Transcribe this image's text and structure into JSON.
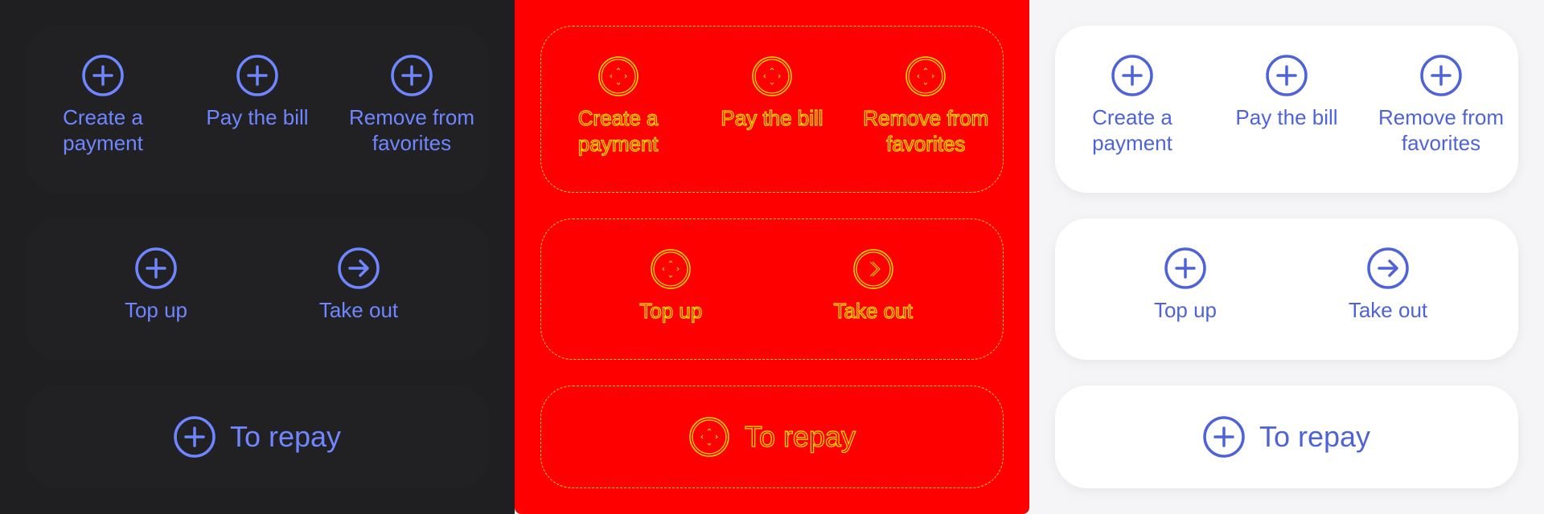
{
  "colors": {
    "dark_background": "#1f1f21",
    "debug_background": "#ff0000",
    "light_background": "#f5f5f7",
    "accent_dark": "#6f86ff",
    "accent_light": "#4f63d9",
    "debug_outline": "#ffe100"
  },
  "actions": {
    "create_payment": {
      "label": "Create a\npayment",
      "icon": "plus-circle-icon"
    },
    "pay_bill": {
      "label": "Pay the bill",
      "icon": "plus-circle-icon"
    },
    "remove_favorites": {
      "label": "Remove from\nfavorites",
      "icon": "plus-circle-icon"
    },
    "top_up": {
      "label": "Top up",
      "icon": "plus-circle-icon"
    },
    "take_out": {
      "label": "Take out",
      "icon": "arrow-right-circle-icon"
    },
    "to_repay": {
      "label": "To repay",
      "icon": "plus-circle-icon"
    }
  }
}
